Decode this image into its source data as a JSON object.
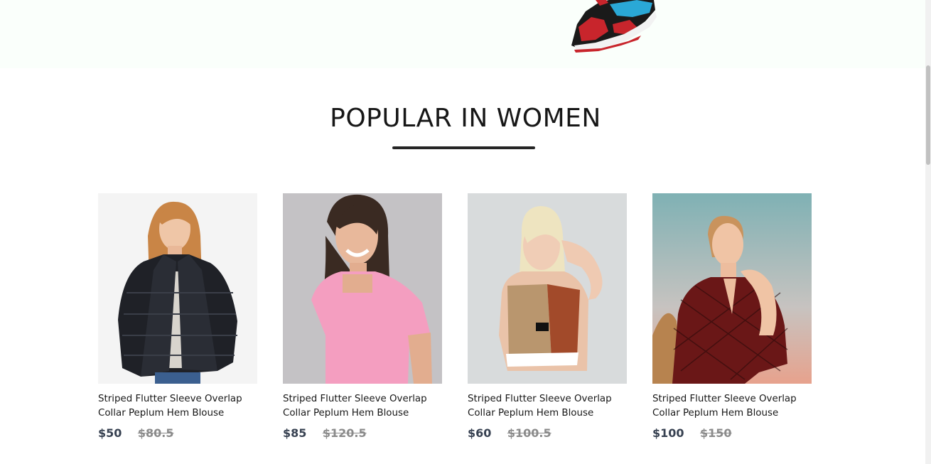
{
  "hero": {
    "shoe_image": "sneaker-image"
  },
  "section": {
    "title": "POPULAR IN WOMEN"
  },
  "products": [
    {
      "name_line1": "Striped Flutter Sleeve Overlap",
      "name_line2": "Collar Peplum Hem Blouse",
      "price": "$50",
      "old_price": "$80.5",
      "image": "woman-black-fur-jacket-photo"
    },
    {
      "name_line1": "Striped Flutter Sleeve Overlap",
      "name_line2": "Collar Peplum Hem Blouse",
      "price": "$85",
      "old_price": "$120.5",
      "image": "woman-pink-top-photo"
    },
    {
      "name_line1": "Striped Flutter Sleeve Overlap",
      "name_line2": "Collar Peplum Hem Blouse",
      "price": "$60",
      "old_price": "$100.5",
      "image": "woman-sports-bra-photo"
    },
    {
      "name_line1": "Striped Flutter Sleeve Overlap",
      "name_line2": "Collar Peplum Hem Blouse",
      "price": "$100",
      "old_price": "$150",
      "image": "woman-red-blouse-photo"
    }
  ],
  "colors": {
    "hero_bg": "#fafffb",
    "title": "#171717",
    "price": "#374151",
    "old_price": "#8b8b8b"
  }
}
